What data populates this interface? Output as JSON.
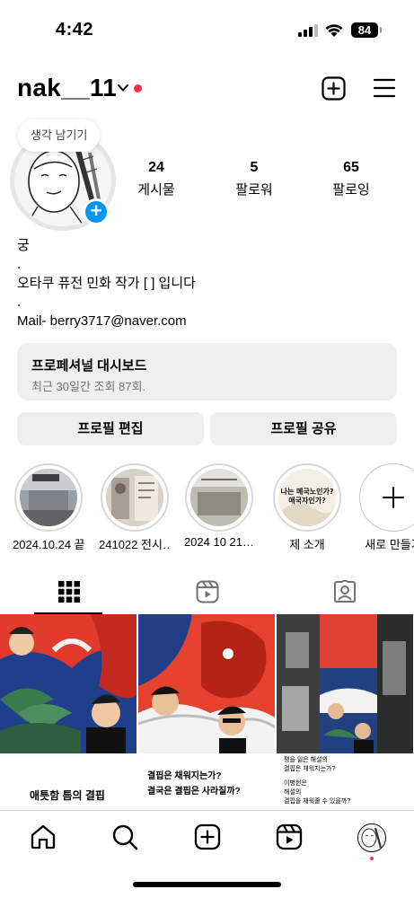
{
  "status_bar": {
    "time": "4:42",
    "battery": "84"
  },
  "header": {
    "username": "nak__11",
    "icons": [
      "chevron-down-icon",
      "plus-square-icon",
      "hamburger-menu-icon"
    ]
  },
  "profile": {
    "note": "생각 남기기",
    "stats": [
      {
        "num": "24",
        "label": "게시물"
      },
      {
        "num": "5",
        "label": "팔로워"
      },
      {
        "num": "65",
        "label": "팔로잉"
      }
    ],
    "bio": [
      "궁",
      ".",
      "오타쿠 퓨전 민화 작가 [ ] 입니다",
      ".",
      "Mail- berry3717@naver.com"
    ]
  },
  "dashboard": {
    "title": "프로페셔널 대시보드",
    "subtitle": "최근 30일간 조회 87회."
  },
  "buttons": {
    "edit": "프로필 편집",
    "share": "프로필 공유"
  },
  "highlights": [
    {
      "label": "2024.10.24 끝"
    },
    {
      "label": "241022 전시…"
    },
    {
      "label": "2024 10 21…"
    },
    {
      "label": "제 소개"
    },
    {
      "label": "새로 만들기"
    }
  ],
  "highlight_text": {
    "h4_line1": "나는 메국노인가?",
    "h4_line2": "애국자인가?"
  },
  "tabs": [
    "grid-icon",
    "reels-icon",
    "tagged-icon"
  ],
  "posts": [
    {
      "caption": [
        "애틋함 틈의 결핍"
      ]
    },
    {
      "caption": [
        "결핍은 채워지는가?",
        "결국은 결핍은 사라질까?"
      ]
    },
    {
      "caption": [
        "평을 잃은 해설의",
        "결핍은 채워지는가?",
        "이병헌은",
        "해설의",
        "결핍을 채워줄 수 있을까?"
      ]
    }
  ],
  "bottom_nav": [
    "home-icon",
    "search-icon",
    "create-icon",
    "reels-icon",
    "profile-avatar"
  ],
  "colors": {
    "accent": "#0095f6",
    "notification": "#ff3040",
    "button_bg": "#efefef",
    "secondary_text": "#737373"
  }
}
